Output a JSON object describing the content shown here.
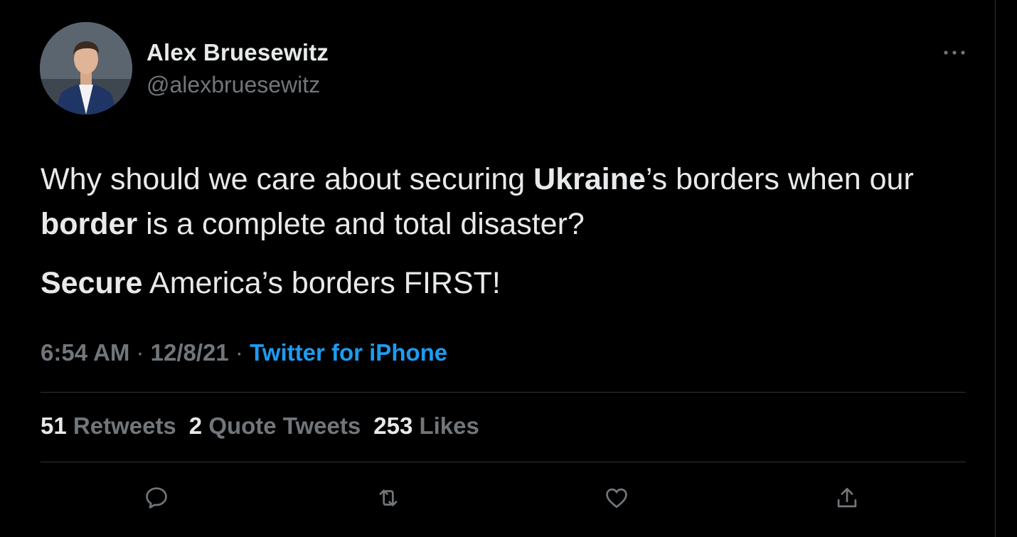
{
  "user": {
    "display_name": "Alex Bruesewitz",
    "handle": "@alexbruesewitz"
  },
  "tweet": {
    "p1_a": "Why should we care about securing ",
    "p1_b": "Ukraine",
    "p1_c": "’s borders when our ",
    "p1_d": "border",
    "p1_e": " is a complete and total disaster?",
    "p2_a": "Secure",
    "p2_b": " America’s borders FIRST!"
  },
  "meta": {
    "time": "6:54 AM",
    "sep1": " · ",
    "date": "12/8/21",
    "sep2": " · ",
    "source": "Twitter for iPhone"
  },
  "stats": {
    "retweets_count": "51",
    "retweets_label": "Retweets",
    "quotes_count": "2",
    "quotes_label": "Quote Tweets",
    "likes_count": "253",
    "likes_label": "Likes"
  },
  "icons": {
    "more": "more-horizontal-icon",
    "reply": "reply-icon",
    "retweet": "retweet-icon",
    "like": "heart-icon",
    "share": "share-icon"
  },
  "colors": {
    "background": "#000000",
    "text": "#e7e9ea",
    "secondary": "#71767b",
    "link": "#1d9bf0",
    "divider": "#2f3336"
  }
}
